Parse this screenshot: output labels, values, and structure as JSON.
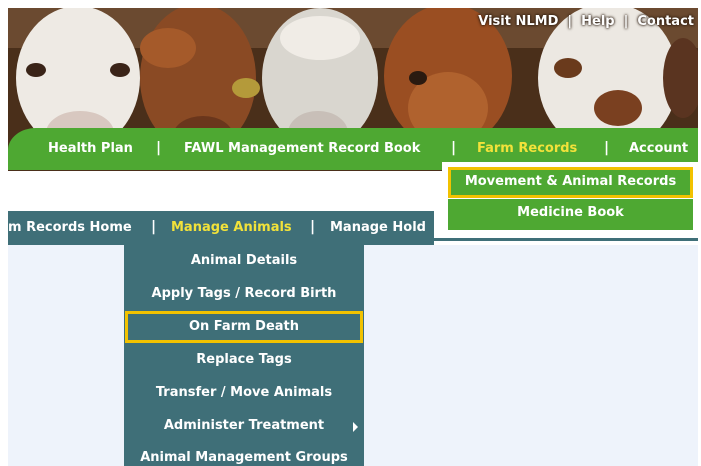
{
  "top_links": [
    "Visit NLMD",
    "Help",
    "Contact"
  ],
  "main_nav": {
    "items": [
      "Health Plan",
      "FAWL Management Record Book",
      "Farm Records",
      "Account"
    ],
    "active": "Farm Records"
  },
  "farm_records_menu": {
    "items": [
      "Movement & Animal Records",
      "Medicine Book"
    ],
    "selected": "Movement & Animal Records"
  },
  "sub_nav": {
    "items": [
      "m Records Home",
      "Manage Animals",
      "Manage Hold"
    ],
    "active": "Manage Animals"
  },
  "manage_animals_menu": {
    "items": [
      "Animal Details",
      "Apply Tags / Record Birth",
      "On Farm Death",
      "Replace Tags",
      "Transfer / Move Animals",
      "Administer Treatment",
      "Animal Management Groups"
    ],
    "selected": "On Farm Death",
    "has_submenu": "Administer Treatment"
  },
  "colors": {
    "nav_green": "#4ea832",
    "nav_teal": "#3f6f78",
    "active_text": "#f2e23a",
    "highlight_border": "#f2c200",
    "content_bg": "#eef3fb"
  }
}
